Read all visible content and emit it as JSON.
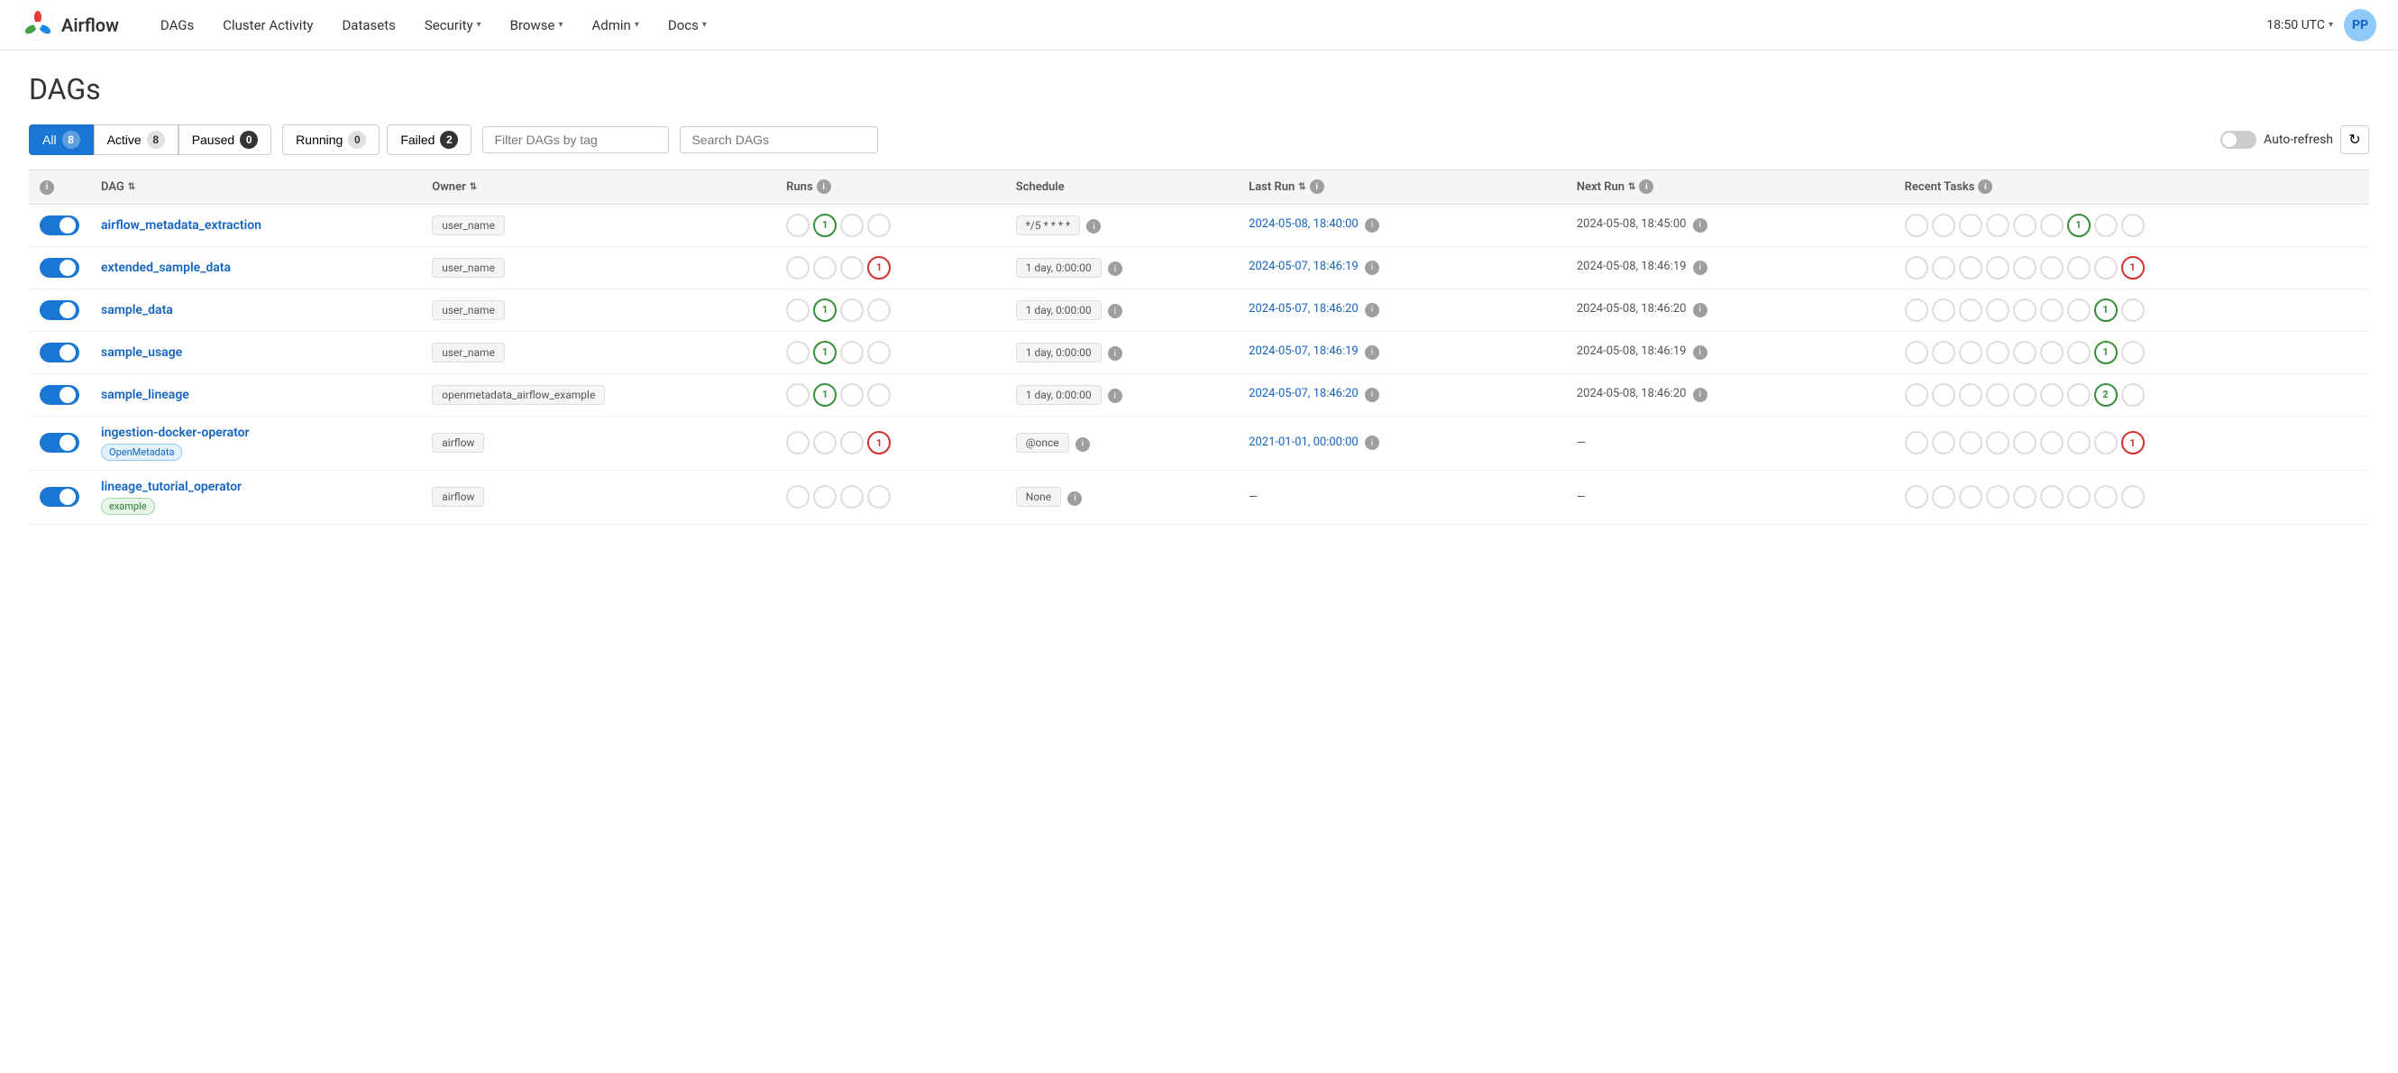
{
  "app": {
    "title": "Airflow",
    "time": "18:50 UTC",
    "user_initials": "PP"
  },
  "nav": {
    "links": [
      {
        "id": "dags",
        "label": "DAGs",
        "has_dropdown": false
      },
      {
        "id": "cluster-activity",
        "label": "Cluster Activity",
        "has_dropdown": false
      },
      {
        "id": "datasets",
        "label": "Datasets",
        "has_dropdown": false
      },
      {
        "id": "security",
        "label": "Security",
        "has_dropdown": true
      },
      {
        "id": "browse",
        "label": "Browse",
        "has_dropdown": true
      },
      {
        "id": "admin",
        "label": "Admin",
        "has_dropdown": true
      },
      {
        "id": "docs",
        "label": "Docs",
        "has_dropdown": true
      }
    ]
  },
  "page": {
    "title": "DAGs"
  },
  "filters": {
    "all_label": "All",
    "all_count": "8",
    "active_label": "Active",
    "active_count": "8",
    "paused_label": "Paused",
    "paused_count": "0",
    "running_label": "Running",
    "running_count": "0",
    "failed_label": "Failed",
    "failed_count": "2",
    "tag_placeholder": "Filter DAGs by tag",
    "search_placeholder": "Search DAGs",
    "auto_refresh_label": "Auto-refresh"
  },
  "table": {
    "headers": {
      "dag": "DAG",
      "owner": "Owner",
      "runs": "Runs",
      "schedule": "Schedule",
      "last_run": "Last Run",
      "next_run": "Next Run",
      "recent_tasks": "Recent Tasks"
    },
    "rows": [
      {
        "id": "airflow_metadata_extraction",
        "name": "airflow_metadata_extraction",
        "tag": null,
        "tag_class": null,
        "owner": "user_name",
        "runs": [
          {
            "type": "empty",
            "label": ""
          },
          {
            "type": "success",
            "label": "1"
          },
          {
            "type": "empty",
            "label": ""
          },
          {
            "type": "empty",
            "label": ""
          }
        ],
        "schedule": "*/5 * * * *",
        "last_run": "2024-05-08, 18:40:00",
        "next_run": "2024-05-08, 18:45:00",
        "tasks": [
          {
            "type": "empty",
            "label": ""
          },
          {
            "type": "empty",
            "label": ""
          },
          {
            "type": "empty",
            "label": ""
          },
          {
            "type": "empty",
            "label": ""
          },
          {
            "type": "empty",
            "label": ""
          },
          {
            "type": "empty",
            "label": ""
          },
          {
            "type": "success",
            "label": "1"
          },
          {
            "type": "empty",
            "label": ""
          },
          {
            "type": "empty",
            "label": ""
          }
        ]
      },
      {
        "id": "extended_sample_data",
        "name": "extended_sample_data",
        "tag": null,
        "tag_class": null,
        "owner": "user_name",
        "runs": [
          {
            "type": "empty",
            "label": ""
          },
          {
            "type": "empty",
            "label": ""
          },
          {
            "type": "empty",
            "label": ""
          },
          {
            "type": "failed",
            "label": "1"
          }
        ],
        "schedule": "1 day, 0:00:00",
        "last_run": "2024-05-07, 18:46:19",
        "next_run": "2024-05-08, 18:46:19",
        "tasks": [
          {
            "type": "empty",
            "label": ""
          },
          {
            "type": "empty",
            "label": ""
          },
          {
            "type": "empty",
            "label": ""
          },
          {
            "type": "empty",
            "label": ""
          },
          {
            "type": "empty",
            "label": ""
          },
          {
            "type": "empty",
            "label": ""
          },
          {
            "type": "empty",
            "label": ""
          },
          {
            "type": "empty",
            "label": ""
          },
          {
            "type": "failed",
            "label": "1"
          }
        ]
      },
      {
        "id": "sample_data",
        "name": "sample_data",
        "tag": null,
        "tag_class": null,
        "owner": "user_name",
        "runs": [
          {
            "type": "empty",
            "label": ""
          },
          {
            "type": "success",
            "label": "1"
          },
          {
            "type": "empty",
            "label": ""
          },
          {
            "type": "empty",
            "label": ""
          }
        ],
        "schedule": "1 day, 0:00:00",
        "last_run": "2024-05-07, 18:46:20",
        "next_run": "2024-05-08, 18:46:20",
        "tasks": [
          {
            "type": "empty",
            "label": ""
          },
          {
            "type": "empty",
            "label": ""
          },
          {
            "type": "empty",
            "label": ""
          },
          {
            "type": "empty",
            "label": ""
          },
          {
            "type": "empty",
            "label": ""
          },
          {
            "type": "empty",
            "label": ""
          },
          {
            "type": "empty",
            "label": ""
          },
          {
            "type": "success",
            "label": "1"
          },
          {
            "type": "empty",
            "label": ""
          }
        ]
      },
      {
        "id": "sample_usage",
        "name": "sample_usage",
        "tag": null,
        "tag_class": null,
        "owner": "user_name",
        "runs": [
          {
            "type": "empty",
            "label": ""
          },
          {
            "type": "success",
            "label": "1"
          },
          {
            "type": "empty",
            "label": ""
          },
          {
            "type": "empty",
            "label": ""
          }
        ],
        "schedule": "1 day, 0:00:00",
        "last_run": "2024-05-07, 18:46:19",
        "next_run": "2024-05-08, 18:46:19",
        "tasks": [
          {
            "type": "empty",
            "label": ""
          },
          {
            "type": "empty",
            "label": ""
          },
          {
            "type": "empty",
            "label": ""
          },
          {
            "type": "empty",
            "label": ""
          },
          {
            "type": "empty",
            "label": ""
          },
          {
            "type": "empty",
            "label": ""
          },
          {
            "type": "empty",
            "label": ""
          },
          {
            "type": "success",
            "label": "1"
          },
          {
            "type": "empty",
            "label": ""
          }
        ]
      },
      {
        "id": "sample_lineage",
        "name": "sample_lineage",
        "tag": null,
        "tag_class": null,
        "owner": "openmetadata_airflow_example",
        "runs": [
          {
            "type": "empty",
            "label": ""
          },
          {
            "type": "success",
            "label": "1"
          },
          {
            "type": "empty",
            "label": ""
          },
          {
            "type": "empty",
            "label": ""
          }
        ],
        "schedule": "1 day, 0:00:00",
        "last_run": "2024-05-07, 18:46:20",
        "next_run": "2024-05-08, 18:46:20",
        "tasks": [
          {
            "type": "empty",
            "label": ""
          },
          {
            "type": "empty",
            "label": ""
          },
          {
            "type": "empty",
            "label": ""
          },
          {
            "type": "empty",
            "label": ""
          },
          {
            "type": "empty",
            "label": ""
          },
          {
            "type": "empty",
            "label": ""
          },
          {
            "type": "empty",
            "label": ""
          },
          {
            "type": "success",
            "label": "2"
          },
          {
            "type": "empty",
            "label": ""
          }
        ]
      },
      {
        "id": "ingestion-docker-operator",
        "name": "ingestion-docker-operator",
        "tag": "OpenMetadata",
        "tag_class": "tag-openmetadata",
        "owner": "airflow",
        "runs": [
          {
            "type": "empty",
            "label": ""
          },
          {
            "type": "empty",
            "label": ""
          },
          {
            "type": "empty",
            "label": ""
          },
          {
            "type": "failed",
            "label": "1"
          }
        ],
        "schedule": "@once",
        "last_run": "2021-01-01, 00:00:00",
        "next_run": "",
        "tasks": [
          {
            "type": "empty",
            "label": ""
          },
          {
            "type": "empty",
            "label": ""
          },
          {
            "type": "empty",
            "label": ""
          },
          {
            "type": "empty",
            "label": ""
          },
          {
            "type": "empty",
            "label": ""
          },
          {
            "type": "empty",
            "label": ""
          },
          {
            "type": "empty",
            "label": ""
          },
          {
            "type": "empty",
            "label": ""
          },
          {
            "type": "failed",
            "label": "1"
          }
        ]
      },
      {
        "id": "lineage_tutorial_operator",
        "name": "lineage_tutorial_operator",
        "tag": "example",
        "tag_class": "tag-example",
        "owner": "airflow",
        "runs": [
          {
            "type": "empty",
            "label": ""
          },
          {
            "type": "empty",
            "label": ""
          },
          {
            "type": "empty",
            "label": ""
          },
          {
            "type": "empty",
            "label": ""
          }
        ],
        "schedule": "None",
        "last_run": "",
        "next_run": "",
        "tasks": [
          {
            "type": "empty",
            "label": ""
          },
          {
            "type": "empty",
            "label": ""
          },
          {
            "type": "empty",
            "label": ""
          },
          {
            "type": "empty",
            "label": ""
          },
          {
            "type": "empty",
            "label": ""
          },
          {
            "type": "empty",
            "label": ""
          },
          {
            "type": "empty",
            "label": ""
          },
          {
            "type": "empty",
            "label": ""
          },
          {
            "type": "empty",
            "label": ""
          }
        ]
      }
    ]
  }
}
